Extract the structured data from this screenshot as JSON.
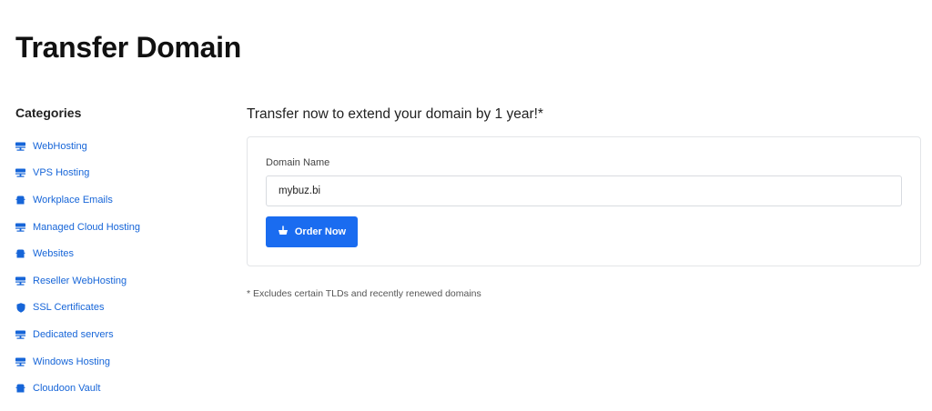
{
  "page": {
    "title": "Transfer Domain"
  },
  "sidebar": {
    "heading": "Categories",
    "items": [
      {
        "label": "WebHosting",
        "icon": "server-icon"
      },
      {
        "label": "VPS Hosting",
        "icon": "server-icon"
      },
      {
        "label": "Workplace Emails",
        "icon": "box-icon"
      },
      {
        "label": "Managed Cloud Hosting",
        "icon": "server-icon"
      },
      {
        "label": "Websites",
        "icon": "box-icon"
      },
      {
        "label": "Reseller WebHosting",
        "icon": "server-icon"
      },
      {
        "label": "SSL Certificates",
        "icon": "shield-icon"
      },
      {
        "label": "Dedicated servers",
        "icon": "server-icon"
      },
      {
        "label": "Windows Hosting",
        "icon": "server-icon"
      },
      {
        "label": "Cloudoon Vault",
        "icon": "box-icon"
      }
    ]
  },
  "main": {
    "subtitle": "Transfer now to extend your domain by 1 year!*",
    "form": {
      "label": "Domain Name",
      "value": "mybuz.bi",
      "button_label": "Order Now",
      "button_icon": "basket-icon"
    },
    "footnote": "* Excludes certain TLDs and recently renewed domains"
  },
  "colors": {
    "accent": "#1a6cf0",
    "link": "#1665d8",
    "border": "#e3e5e8"
  }
}
